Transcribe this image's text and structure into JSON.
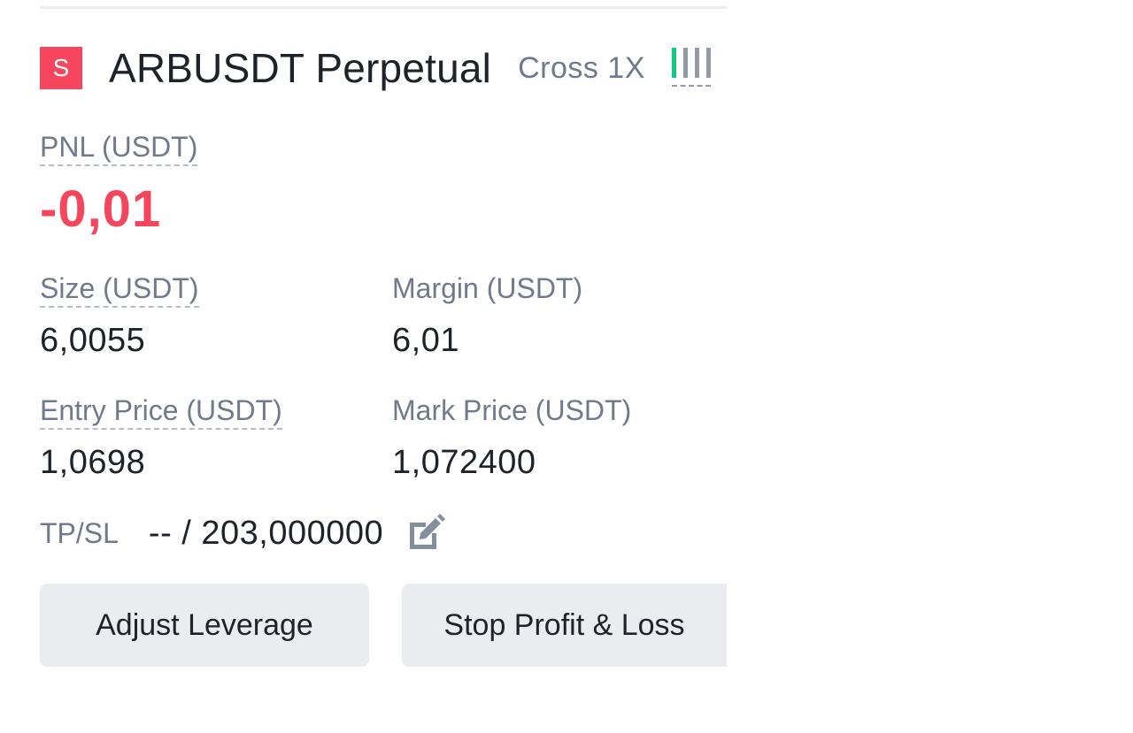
{
  "position": {
    "side_badge": "S",
    "symbol": "ARBUSDT Perpetual",
    "margin_mode": "Cross 1X",
    "pnl_label": "PNL (USDT)",
    "pnl_value": "-0,01",
    "size_label": "Size (USDT)",
    "size_value": "6,0055",
    "margin_label": "Margin (USDT)",
    "margin_value": "6,01",
    "entry_price_label": "Entry Price (USDT)",
    "entry_price_value": "1,0698",
    "mark_price_label": "Mark Price (USDT)",
    "mark_price_value": "1,072400",
    "tpsl_label": "TP/SL",
    "tpsl_value": "-- / 203,000000"
  },
  "actions": {
    "adjust_leverage_label": "Adjust Leverage",
    "stop_profit_loss_label": "Stop Profit & Loss"
  },
  "icons": {
    "risk": "margin-risk-bars-icon",
    "edit": "edit-icon"
  },
  "colors": {
    "short": "#f6465d",
    "loss": "#f6465d",
    "risk_active": "#0ecb81",
    "text_primary": "#1e2329",
    "text_secondary": "#707a8a",
    "button_bg": "#eaecef"
  }
}
